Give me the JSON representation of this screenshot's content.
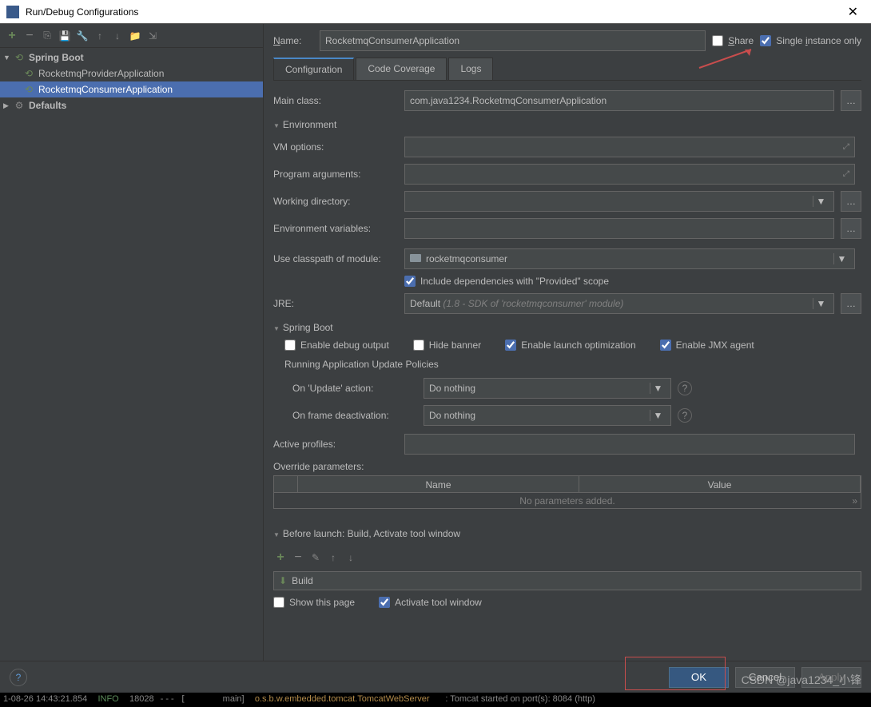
{
  "title": "Run/Debug Configurations",
  "sidebar": {
    "items": [
      {
        "label": "Spring Boot",
        "kind": "spring",
        "expanded": true,
        "bold": true
      },
      {
        "label": "RocketmqProviderApplication",
        "kind": "spring-child"
      },
      {
        "label": "RocketmqConsumerApplication",
        "kind": "spring-child",
        "selected": true
      },
      {
        "label": "Defaults",
        "kind": "gear",
        "expanded": false,
        "bold": true
      }
    ]
  },
  "form": {
    "name_label": "Name:",
    "name_value": "RocketmqConsumerApplication",
    "share_label": "Share",
    "single_instance_label": "Single instance only",
    "tabs": [
      "Configuration",
      "Code Coverage",
      "Logs"
    ],
    "main_class_label": "Main class:",
    "main_class_value": "com.java1234.RocketmqConsumerApplication",
    "env_header": "Environment",
    "vm_label": "VM options:",
    "prog_args_label": "Program arguments:",
    "work_dir_label": "Working directory:",
    "env_vars_label": "Environment variables:",
    "classpath_label": "Use classpath of module:",
    "classpath_value": "rocketmqconsumer",
    "include_deps_label": "Include dependencies with \"Provided\" scope",
    "jre_label": "JRE:",
    "jre_value": "Default",
    "jre_hint": "(1.8 - SDK of 'rocketmqconsumer' module)",
    "spring_header": "Spring Boot",
    "cb_debug": "Enable debug output",
    "cb_hide": "Hide banner",
    "cb_launch": "Enable launch optimization",
    "cb_jmx": "Enable JMX agent",
    "policies_header": "Running Application Update Policies",
    "on_update_label": "On 'Update' action:",
    "on_update_value": "Do nothing",
    "on_frame_label": "On frame deactivation:",
    "on_frame_value": "Do nothing",
    "active_profiles_label": "Active profiles:",
    "override_params_label": "Override parameters:",
    "col_name": "Name",
    "col_value": "Value",
    "no_params": "No parameters added.",
    "before_launch_header": "Before launch: Build, Activate tool window",
    "build_item": "Build",
    "show_page": "Show this page",
    "activate_tool": "Activate tool window"
  },
  "buttons": {
    "ok": "OK",
    "cancel": "Cancel",
    "apply": "Apply"
  },
  "watermark": "CSDN @java1234_小锋",
  "status": {
    "time": "1-08-26 14:43:21.854",
    "level": "INFO",
    "pid": "18028",
    "thread": "main]",
    "cls": "o.s.b.w.embedded.tomcat.TomcatWebServer",
    "msg": ": Tomcat started on port(s): 8084 (http)"
  }
}
